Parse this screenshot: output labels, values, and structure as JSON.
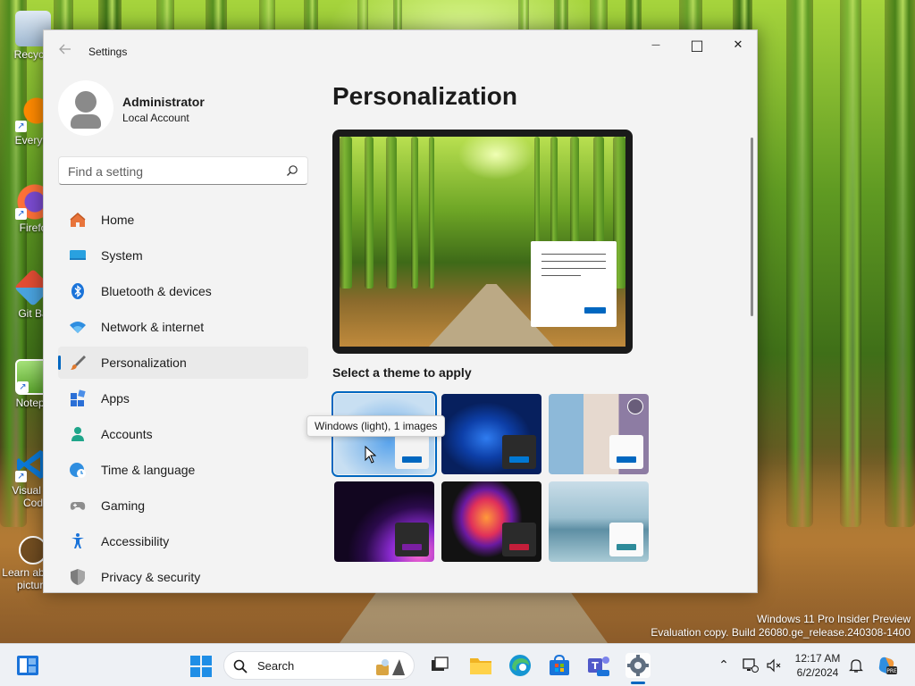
{
  "desktop": {
    "icons": [
      {
        "label": "Recycle"
      },
      {
        "label": "Everyth"
      },
      {
        "label": "Firefo"
      },
      {
        "label": "Git Ba"
      },
      {
        "label": "Notepa"
      },
      {
        "label": "Visual St Cod"
      },
      {
        "label": "Learn ab this picture"
      }
    ],
    "watermark_line1": "Windows 11 Pro Insider Preview",
    "watermark_line2": "Evaluation copy. Build 26080.ge_release.240308-1400"
  },
  "window": {
    "title": "Settings",
    "back_icon": "back-arrow-icon",
    "minimize_glyph": "—",
    "maximize_glyph": "□",
    "close_glyph": "✕"
  },
  "profile": {
    "name": "Administrator",
    "account_type": "Local Account"
  },
  "search": {
    "placeholder": "Find a setting",
    "value": ""
  },
  "nav": {
    "items": [
      {
        "label": "Home",
        "icon": "home-icon"
      },
      {
        "label": "System",
        "icon": "system-icon"
      },
      {
        "label": "Bluetooth & devices",
        "icon": "bluetooth-icon"
      },
      {
        "label": "Network & internet",
        "icon": "wifi-icon"
      },
      {
        "label": "Personalization",
        "icon": "brush-icon",
        "active": true
      },
      {
        "label": "Apps",
        "icon": "apps-icon"
      },
      {
        "label": "Accounts",
        "icon": "person-icon"
      },
      {
        "label": "Time & language",
        "icon": "globe-clock-icon"
      },
      {
        "label": "Gaming",
        "icon": "gamepad-icon"
      },
      {
        "label": "Accessibility",
        "icon": "accessibility-icon"
      },
      {
        "label": "Privacy & security",
        "icon": "shield-icon"
      }
    ]
  },
  "main": {
    "page_title": "Personalization",
    "themes_label": "Select a theme to apply",
    "tooltip": "Windows (light), 1 images",
    "themes": [
      {
        "name": "windows-light",
        "accent": "#0067c0",
        "selected": true
      },
      {
        "name": "windows-dark",
        "accent": "#0078d4"
      },
      {
        "name": "spotlight",
        "accent": "#0067c0",
        "slideshow": true
      },
      {
        "name": "glow",
        "accent": "#7a1fa2"
      },
      {
        "name": "captured-motion",
        "accent": "#c41e3a"
      },
      {
        "name": "flow",
        "accent": "#2e8b9a"
      }
    ]
  },
  "taskbar": {
    "search_text": "Search",
    "clock_time": "12:17 AM",
    "clock_date": "6/2/2024",
    "accent": "#0067c0"
  }
}
